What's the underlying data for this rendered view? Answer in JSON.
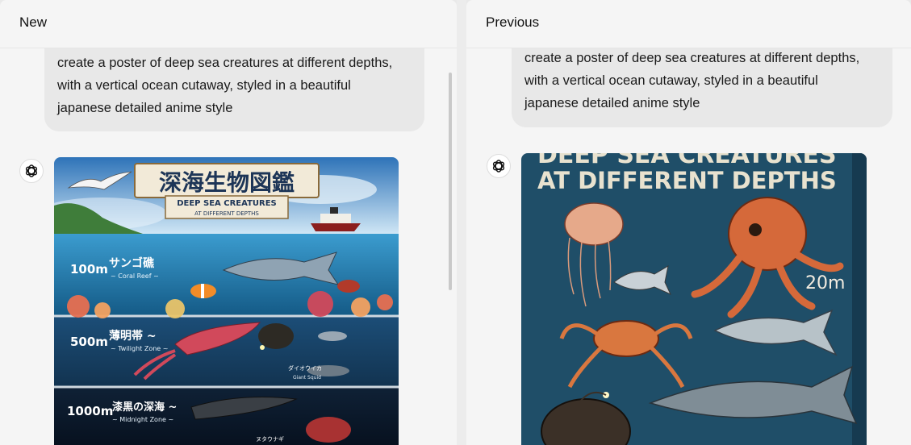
{
  "panels": {
    "left": {
      "title": "New",
      "prompt_lines": [
        "create a poster of deep sea creatures at different depths,",
        "with a vertical ocean cutaway, styled in a beautiful",
        "japanese detailed anime style"
      ],
      "poster": {
        "title_jp": "深海生物図鑑",
        "title_en": "DEEP SEA CREATURES",
        "subtitle_en": "AT DIFFERENT DEPTHS",
        "zones": [
          {
            "depth": "100m",
            "name_jp": "サンゴ礁",
            "name_en": "~ Coral Reef ~"
          },
          {
            "depth": "500m",
            "name_jp": "薄明帯 ~",
            "name_en": "~ Twilight Zone ~"
          },
          {
            "depth": "1000m",
            "name_jp": "漆黒の深海 ~",
            "name_en": "~ Midnight Zone ~"
          }
        ],
        "labels": {
          "squid_jp": "ダイオウイカ",
          "squid_en": "Giant Squid",
          "eel_jp": "ヌタウナギ"
        }
      }
    },
    "right": {
      "title": "Previous",
      "prompt_lines": [
        "create a poster of deep sea creatures at different depths,",
        "with a vertical ocean cutaway, styled in a beautiful",
        "japanese detailed anime style"
      ],
      "poster": {
        "title_top": "DEEP SEA CREATURES",
        "title_bottom": "AT DIFFERENT DEPTHS",
        "depth_label": "20m"
      }
    }
  },
  "colors": {
    "panel_bg": "#f5f5f5",
    "bubble_bg": "#e8e8e8",
    "text": "#1a1a1a"
  },
  "icons": {
    "assistant": "openai-logo-icon"
  }
}
